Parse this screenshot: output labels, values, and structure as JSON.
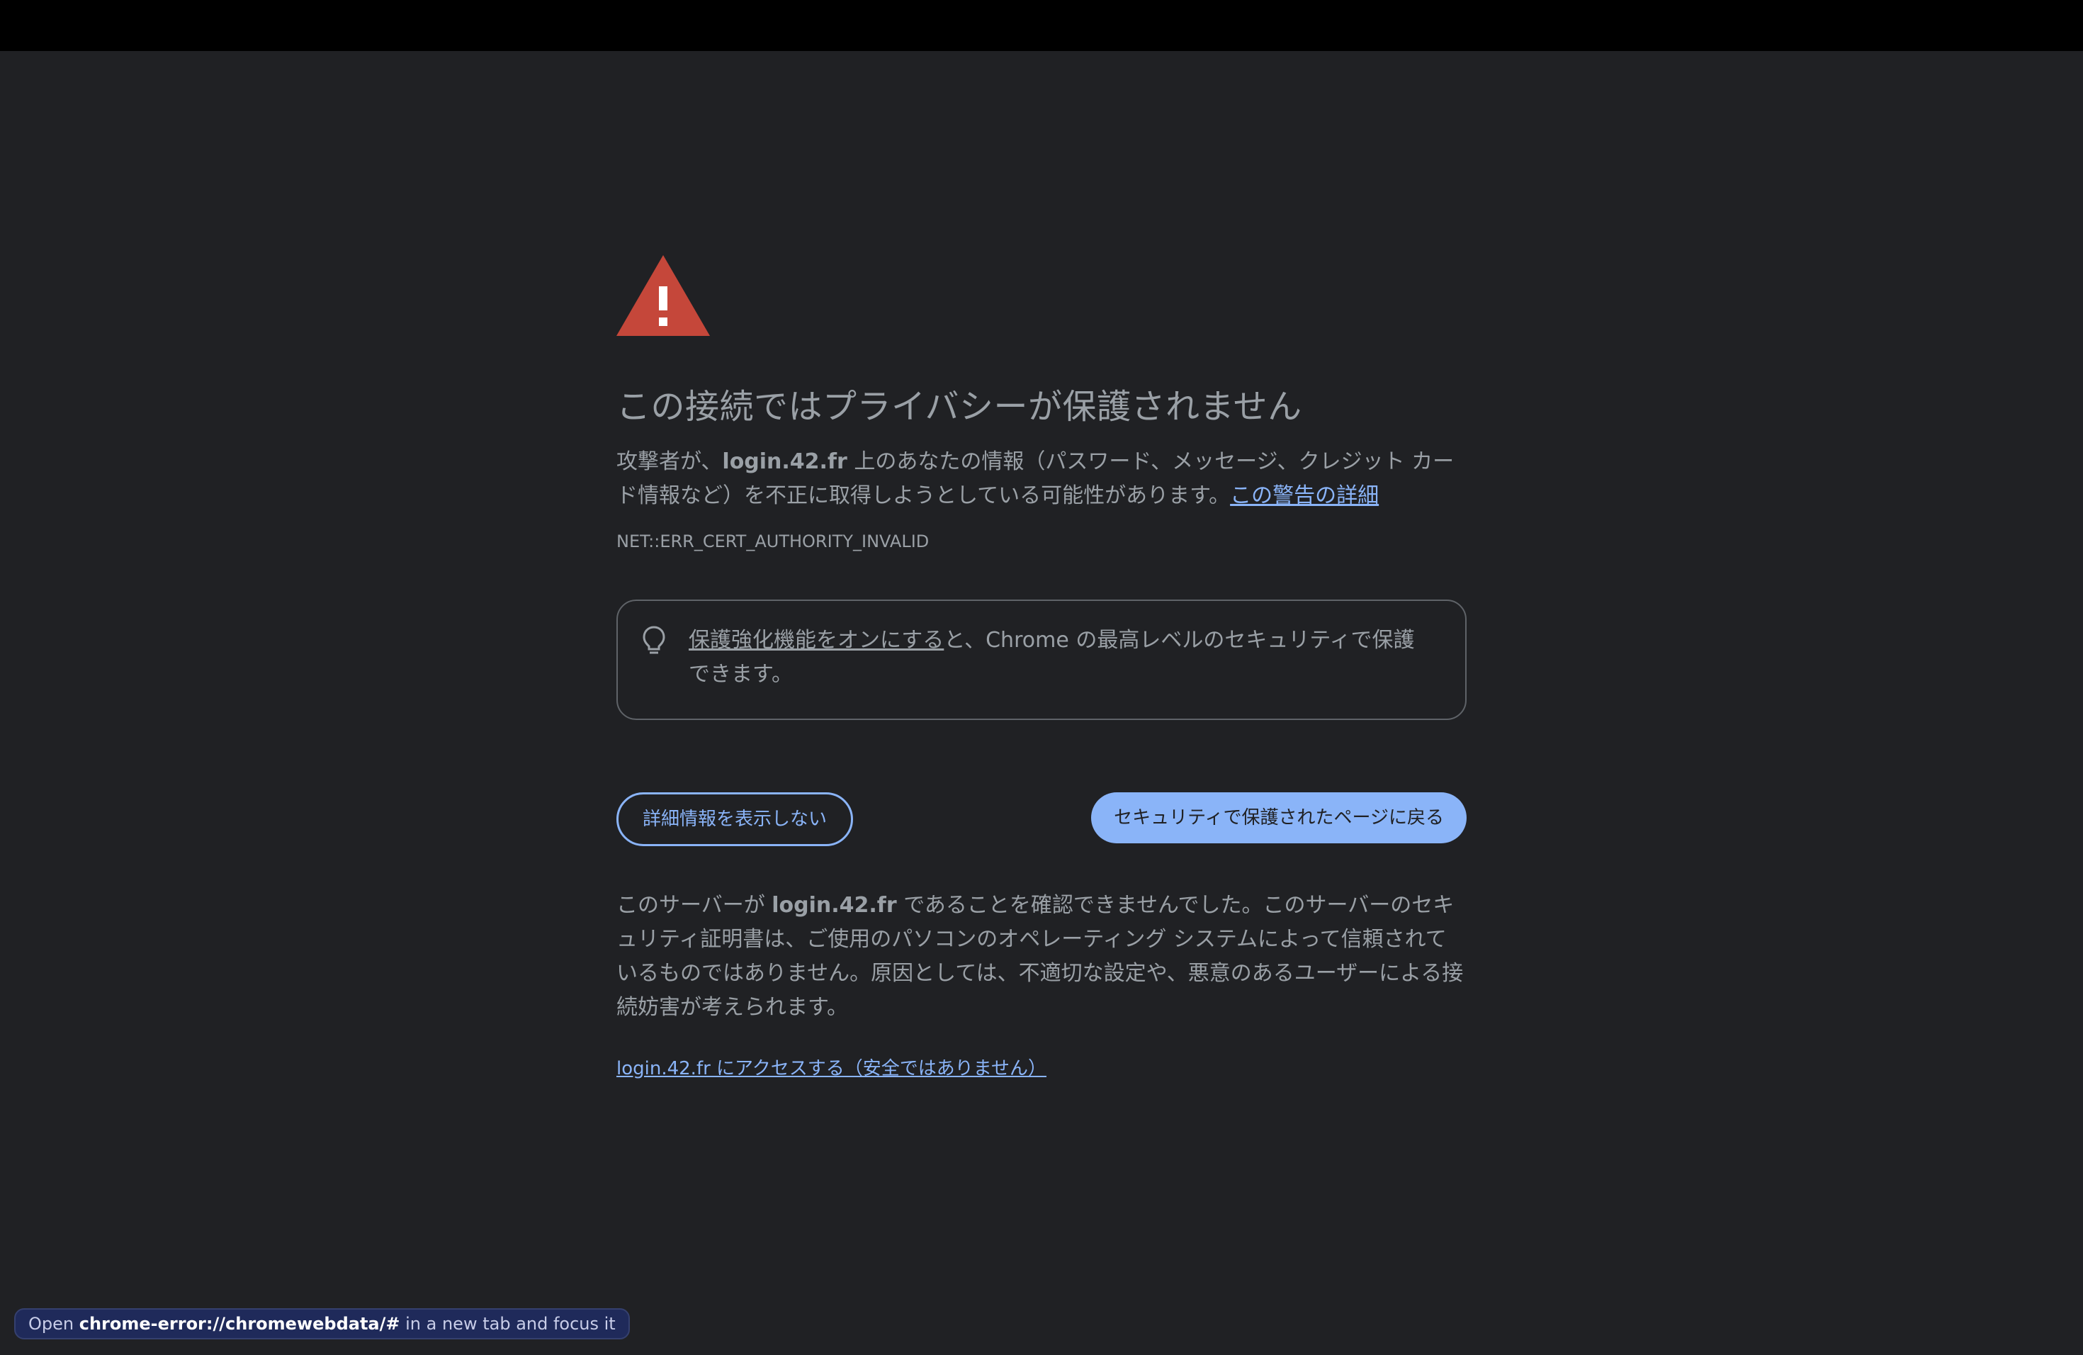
{
  "window": {
    "title": "この接続ではプライバシーが保護されません"
  },
  "colors": {
    "background": "#202124",
    "text": "#9aa0a6",
    "accent": "#8ab4f8",
    "warning": "#c5473a"
  },
  "icons": {
    "warning": "warning-triangle-icon",
    "tip": "lightbulb-icon"
  },
  "heading": "この接続ではプライバシーが保護されません",
  "description": {
    "prefix": "攻撃者が、",
    "host": "login.42.fr",
    "middle": " 上のあなたの情報（パスワード、メッセージ、クレジット カード情報など）を不正に取得しようとしている可能性があります。",
    "link_label": "この警告の詳細"
  },
  "error_code": "NET::ERR_CERT_AUTHORITY_INVALID",
  "enhanced_protection": {
    "link_label": "保護強化機能をオンにする",
    "text": "と、Chrome の最高レベルのセキュリティで保護できます。"
  },
  "buttons": {
    "hide_details_label": "詳細情報を表示しない",
    "back_to_safety_label": "セキュリティで保護されたページに戻る"
  },
  "details": {
    "prefix": "このサーバーが ",
    "host": "login.42.fr",
    "text": " であることを確認できませんでした。このサーバーのセキュリティ証明書は、ご使用のパソコンのオペレーティング システムによって信頼されているものではありません。原因としては、不適切な設定や、悪意のあるユーザーによる接続妨害が考えられます。"
  },
  "proceed_link_label": "login.42.fr にアクセスする（安全ではありません）",
  "status_bubble": {
    "prefix": "Open ",
    "url": "chrome-error://chromewebdata/#",
    "suffix": " in a new tab and focus it"
  }
}
